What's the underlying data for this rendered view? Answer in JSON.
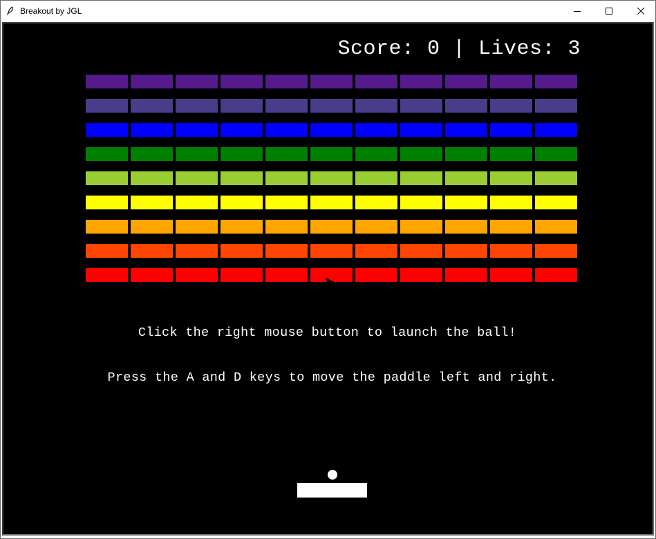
{
  "window": {
    "title": "Breakout by JGL",
    "icon": "feather-icon",
    "controls": [
      "minimize-icon",
      "maximize-icon",
      "close-icon"
    ]
  },
  "game": {
    "hud": "Score: 0 | Lives: 3",
    "score": 0,
    "lives": 3,
    "instructions": [
      "Click the right mouse button to launch the ball!",
      "Press the A and D keys to move the paddle left and right."
    ],
    "brick_columns": 11,
    "brick_rows": [
      {
        "color": "#551a8b"
      },
      {
        "color": "#483d8b"
      },
      {
        "color": "#0000ff"
      },
      {
        "color": "#008000"
      },
      {
        "color": "#9acd32"
      },
      {
        "color": "#ffff00"
      },
      {
        "color": "#ffa500"
      },
      {
        "color": "#ff4500"
      },
      {
        "color": "#ff0000"
      }
    ],
    "background": "#000000",
    "paddle_color": "#ffffff",
    "ball_color": "#ffffff"
  }
}
